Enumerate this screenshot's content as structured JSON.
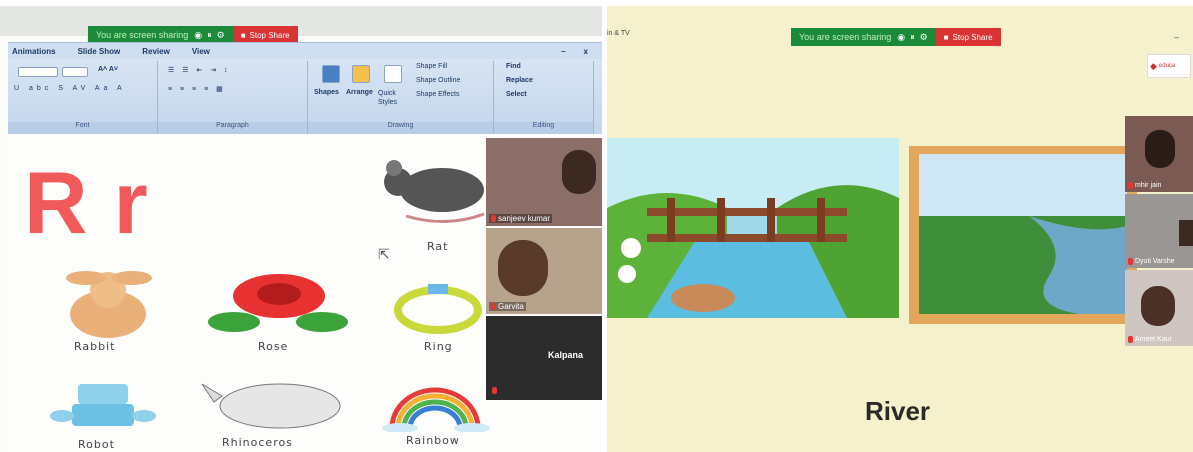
{
  "left": {
    "share_bar": {
      "status": "You are screen sharing",
      "stop": "Stop Share"
    },
    "ribbon": {
      "tabs": [
        "Animations",
        "Slide Show",
        "Review",
        "View"
      ],
      "groups": {
        "font": "Font",
        "paragraph": "Paragraph",
        "drawing": "Drawing",
        "editing": "Editing"
      },
      "buttons": {
        "shapes": "Shapes",
        "arrange": "Arrange",
        "quick_styles": "Quick Styles",
        "shape_fill": "Shape Fill",
        "shape_outline": "Shape Outline",
        "shape_effects": "Shape Effects",
        "find": "Find",
        "replace": "Replace",
        "select": "Select"
      },
      "window_controls": {
        "minimize": "–",
        "close": "x"
      }
    },
    "slide": {
      "letter": "Rr",
      "items": [
        "Rat",
        "Rabbit",
        "Rose",
        "Ring",
        "Robot",
        "Rhinoceros",
        "Rainbow"
      ]
    },
    "participants": [
      "sanjeev kumar",
      "Garvita",
      "Kalpana"
    ]
  },
  "right": {
    "title": "in & TV",
    "share_bar": {
      "status": "You are screen sharing",
      "stop": "Stop Share"
    },
    "logo": "educa",
    "word": "River",
    "participants": [
      "mhir jain",
      "Dyuti Varshe",
      "Ameet Kaur"
    ]
  },
  "colors": {
    "share_green": "#1b8b39",
    "stop_red": "#d93333",
    "letter_red": "#f05a5a",
    "ribbon_blue": "#c4d6ec"
  }
}
